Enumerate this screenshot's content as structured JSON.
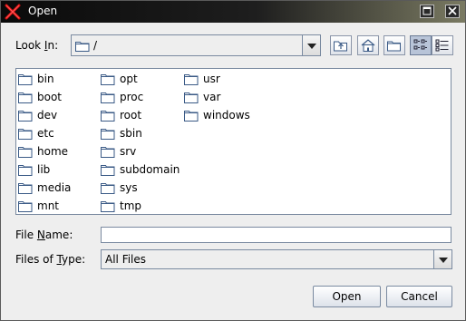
{
  "window": {
    "title": "Open"
  },
  "look_in": {
    "label_pre": "Look ",
    "label_mnemonic": "I",
    "label_post": "n:",
    "value": "/"
  },
  "files": [
    {
      "name": "bin",
      "icon": "folder-icon"
    },
    {
      "name": "boot",
      "icon": "folder-icon"
    },
    {
      "name": "dev",
      "icon": "folder-icon"
    },
    {
      "name": "etc",
      "icon": "folder-icon"
    },
    {
      "name": "home",
      "icon": "folder-icon"
    },
    {
      "name": "lib",
      "icon": "folder-icon"
    },
    {
      "name": "media",
      "icon": "folder-icon"
    },
    {
      "name": "mnt",
      "icon": "folder-icon"
    },
    {
      "name": "opt",
      "icon": "folder-icon"
    },
    {
      "name": "proc",
      "icon": "folder-icon"
    },
    {
      "name": "root",
      "icon": "folder-icon"
    },
    {
      "name": "sbin",
      "icon": "folder-icon"
    },
    {
      "name": "srv",
      "icon": "folder-icon"
    },
    {
      "name": "subdomain",
      "icon": "folder-icon"
    },
    {
      "name": "sys",
      "icon": "folder-icon"
    },
    {
      "name": "tmp",
      "icon": "folder-icon"
    },
    {
      "name": "usr",
      "icon": "folder-icon"
    },
    {
      "name": "var",
      "icon": "folder-icon"
    },
    {
      "name": "windows",
      "icon": "folder-icon"
    }
  ],
  "file_name": {
    "label_pre": "File ",
    "label_mnemonic": "N",
    "label_post": "ame:",
    "value": ""
  },
  "files_of_type": {
    "label_pre": "Files of ",
    "label_mnemonic": "T",
    "label_post": "ype:",
    "value": "All Files"
  },
  "buttons": {
    "open": "Open",
    "cancel": "Cancel"
  }
}
